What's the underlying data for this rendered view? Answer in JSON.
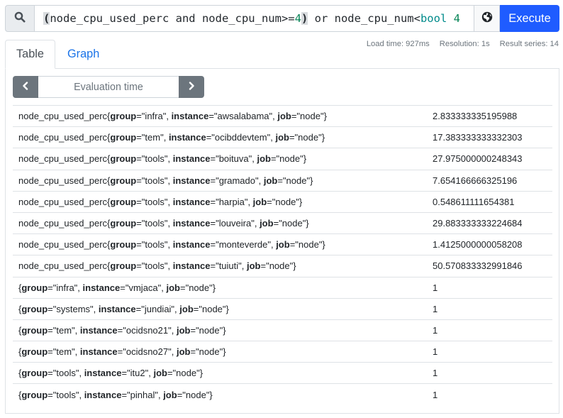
{
  "query": {
    "search_icon": "search-icon",
    "tokens": [
      {
        "text": "(",
        "type": "paren"
      },
      {
        "text": "node_cpu_used_perc and node_cpu_num>=",
        "type": "plain"
      },
      {
        "text": "4",
        "type": "num"
      },
      {
        "text": ")",
        "type": "paren"
      },
      {
        "text": " or node_cpu_num<",
        "type": "plain"
      },
      {
        "text": "bool",
        "type": "kw"
      },
      {
        "text": " ",
        "type": "plain"
      },
      {
        "text": "4",
        "type": "num"
      }
    ],
    "metrics_explorer_icon": "globe-icon",
    "execute_label": "Execute",
    "accent_color": "#1f5cff"
  },
  "stats": {
    "load_time": "Load time: 927ms",
    "resolution": "Resolution: 1s",
    "result_series": "Result series: 14"
  },
  "tabs": [
    {
      "label": "Table",
      "active": true
    },
    {
      "label": "Graph",
      "active": false
    }
  ],
  "table_view": {
    "eval_prev_icon": "chevron-left-icon",
    "eval_next_icon": "chevron-right-icon",
    "eval_placeholder": "Evaluation time",
    "rows": [
      {
        "metric": "node_cpu_used_perc",
        "labels": [
          [
            "group",
            "infra"
          ],
          [
            "instance",
            "awsalabama"
          ],
          [
            "job",
            "node"
          ]
        ],
        "value": "2.833333335195988"
      },
      {
        "metric": "node_cpu_used_perc",
        "labels": [
          [
            "group",
            "tem"
          ],
          [
            "instance",
            "ocibddevtem"
          ],
          [
            "job",
            "node"
          ]
        ],
        "value": "17.383333333332303"
      },
      {
        "metric": "node_cpu_used_perc",
        "labels": [
          [
            "group",
            "tools"
          ],
          [
            "instance",
            "boituva"
          ],
          [
            "job",
            "node"
          ]
        ],
        "value": "27.975000000248343"
      },
      {
        "metric": "node_cpu_used_perc",
        "labels": [
          [
            "group",
            "tools"
          ],
          [
            "instance",
            "gramado"
          ],
          [
            "job",
            "node"
          ]
        ],
        "value": "7.654166666325196"
      },
      {
        "metric": "node_cpu_used_perc",
        "labels": [
          [
            "group",
            "tools"
          ],
          [
            "instance",
            "harpia"
          ],
          [
            "job",
            "node"
          ]
        ],
        "value": "0.548611111654381"
      },
      {
        "metric": "node_cpu_used_perc",
        "labels": [
          [
            "group",
            "tools"
          ],
          [
            "instance",
            "louveira"
          ],
          [
            "job",
            "node"
          ]
        ],
        "value": "29.883333333224684"
      },
      {
        "metric": "node_cpu_used_perc",
        "labels": [
          [
            "group",
            "tools"
          ],
          [
            "instance",
            "monteverde"
          ],
          [
            "job",
            "node"
          ]
        ],
        "value": "1.4125000000058208"
      },
      {
        "metric": "node_cpu_used_perc",
        "labels": [
          [
            "group",
            "tools"
          ],
          [
            "instance",
            "tuiuti"
          ],
          [
            "job",
            "node"
          ]
        ],
        "value": "50.570833332991846"
      },
      {
        "metric": "",
        "labels": [
          [
            "group",
            "infra"
          ],
          [
            "instance",
            "vmjaca"
          ],
          [
            "job",
            "node"
          ]
        ],
        "value": "1"
      },
      {
        "metric": "",
        "labels": [
          [
            "group",
            "systems"
          ],
          [
            "instance",
            "jundiai"
          ],
          [
            "job",
            "node"
          ]
        ],
        "value": "1"
      },
      {
        "metric": "",
        "labels": [
          [
            "group",
            "tem"
          ],
          [
            "instance",
            "ocidsno21"
          ],
          [
            "job",
            "node"
          ]
        ],
        "value": "1"
      },
      {
        "metric": "",
        "labels": [
          [
            "group",
            "tem"
          ],
          [
            "instance",
            "ocidsno27"
          ],
          [
            "job",
            "node"
          ]
        ],
        "value": "1"
      },
      {
        "metric": "",
        "labels": [
          [
            "group",
            "tools"
          ],
          [
            "instance",
            "itu2"
          ],
          [
            "job",
            "node"
          ]
        ],
        "value": "1"
      },
      {
        "metric": "",
        "labels": [
          [
            "group",
            "tools"
          ],
          [
            "instance",
            "pinhal"
          ],
          [
            "job",
            "node"
          ]
        ],
        "value": "1"
      }
    ]
  }
}
